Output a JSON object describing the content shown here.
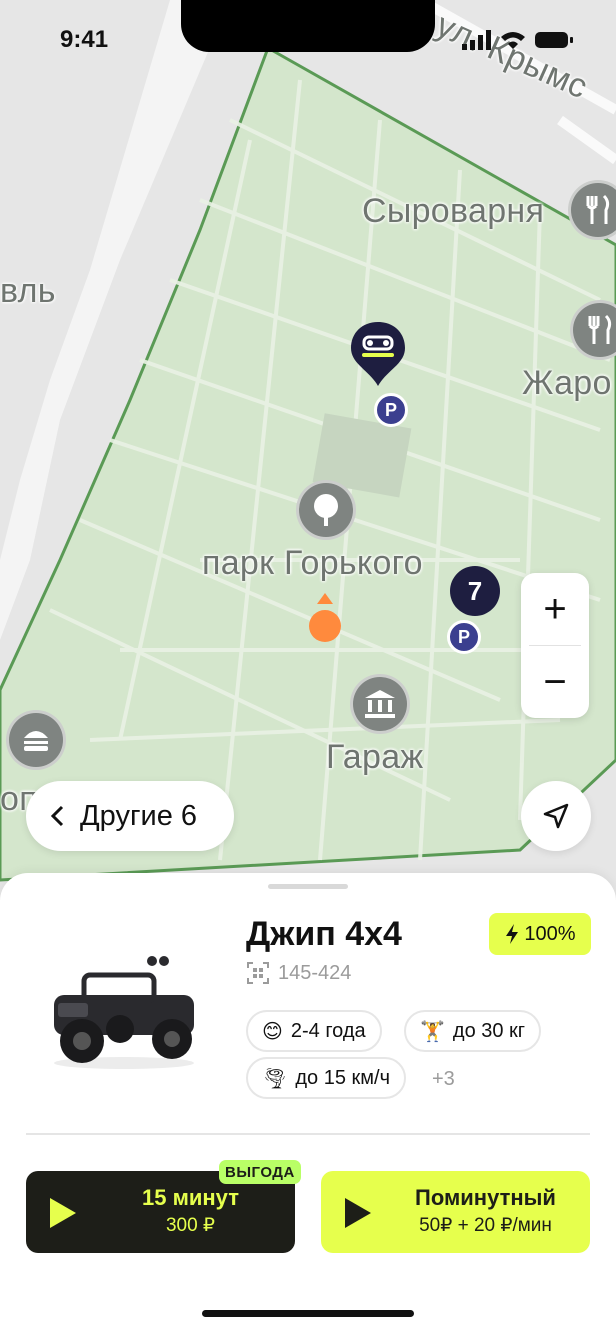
{
  "status_bar": {
    "time": "9:41"
  },
  "map": {
    "labels": {
      "street": "ул. Крымс",
      "syrovarnya": "Сыроварня",
      "zharo": "Жаро",
      "park": "парк Горького",
      "garage": "Гараж",
      "left_edge": "вль",
      "left_bottom": "оп"
    },
    "cluster_count": "7",
    "parking_label": "P",
    "zone_color": "#d4e6cc",
    "zone_border": "#5a9a55"
  },
  "controls": {
    "zoom_in": "+",
    "zoom_out": "−",
    "back_label": "Другие 6"
  },
  "vehicle": {
    "name": "Джип 4x4",
    "battery": "100%",
    "code": "145-424",
    "chips": {
      "age": "2-4  года",
      "weight": "до 30 кг",
      "speed": "до 15 км/ч"
    },
    "more": "+3"
  },
  "actions": {
    "package": {
      "badge": "ВЫГОДА",
      "title": "15 минут",
      "price": "300 ₽"
    },
    "per_minute": {
      "title": "Поминутный",
      "price": "50₽ + 20 ₽/мин"
    }
  },
  "colors": {
    "accent": "#e6ff4d",
    "dark": "#1d1e18",
    "user_dot": "#ff8a3d",
    "parking": "#3b3f8f"
  }
}
